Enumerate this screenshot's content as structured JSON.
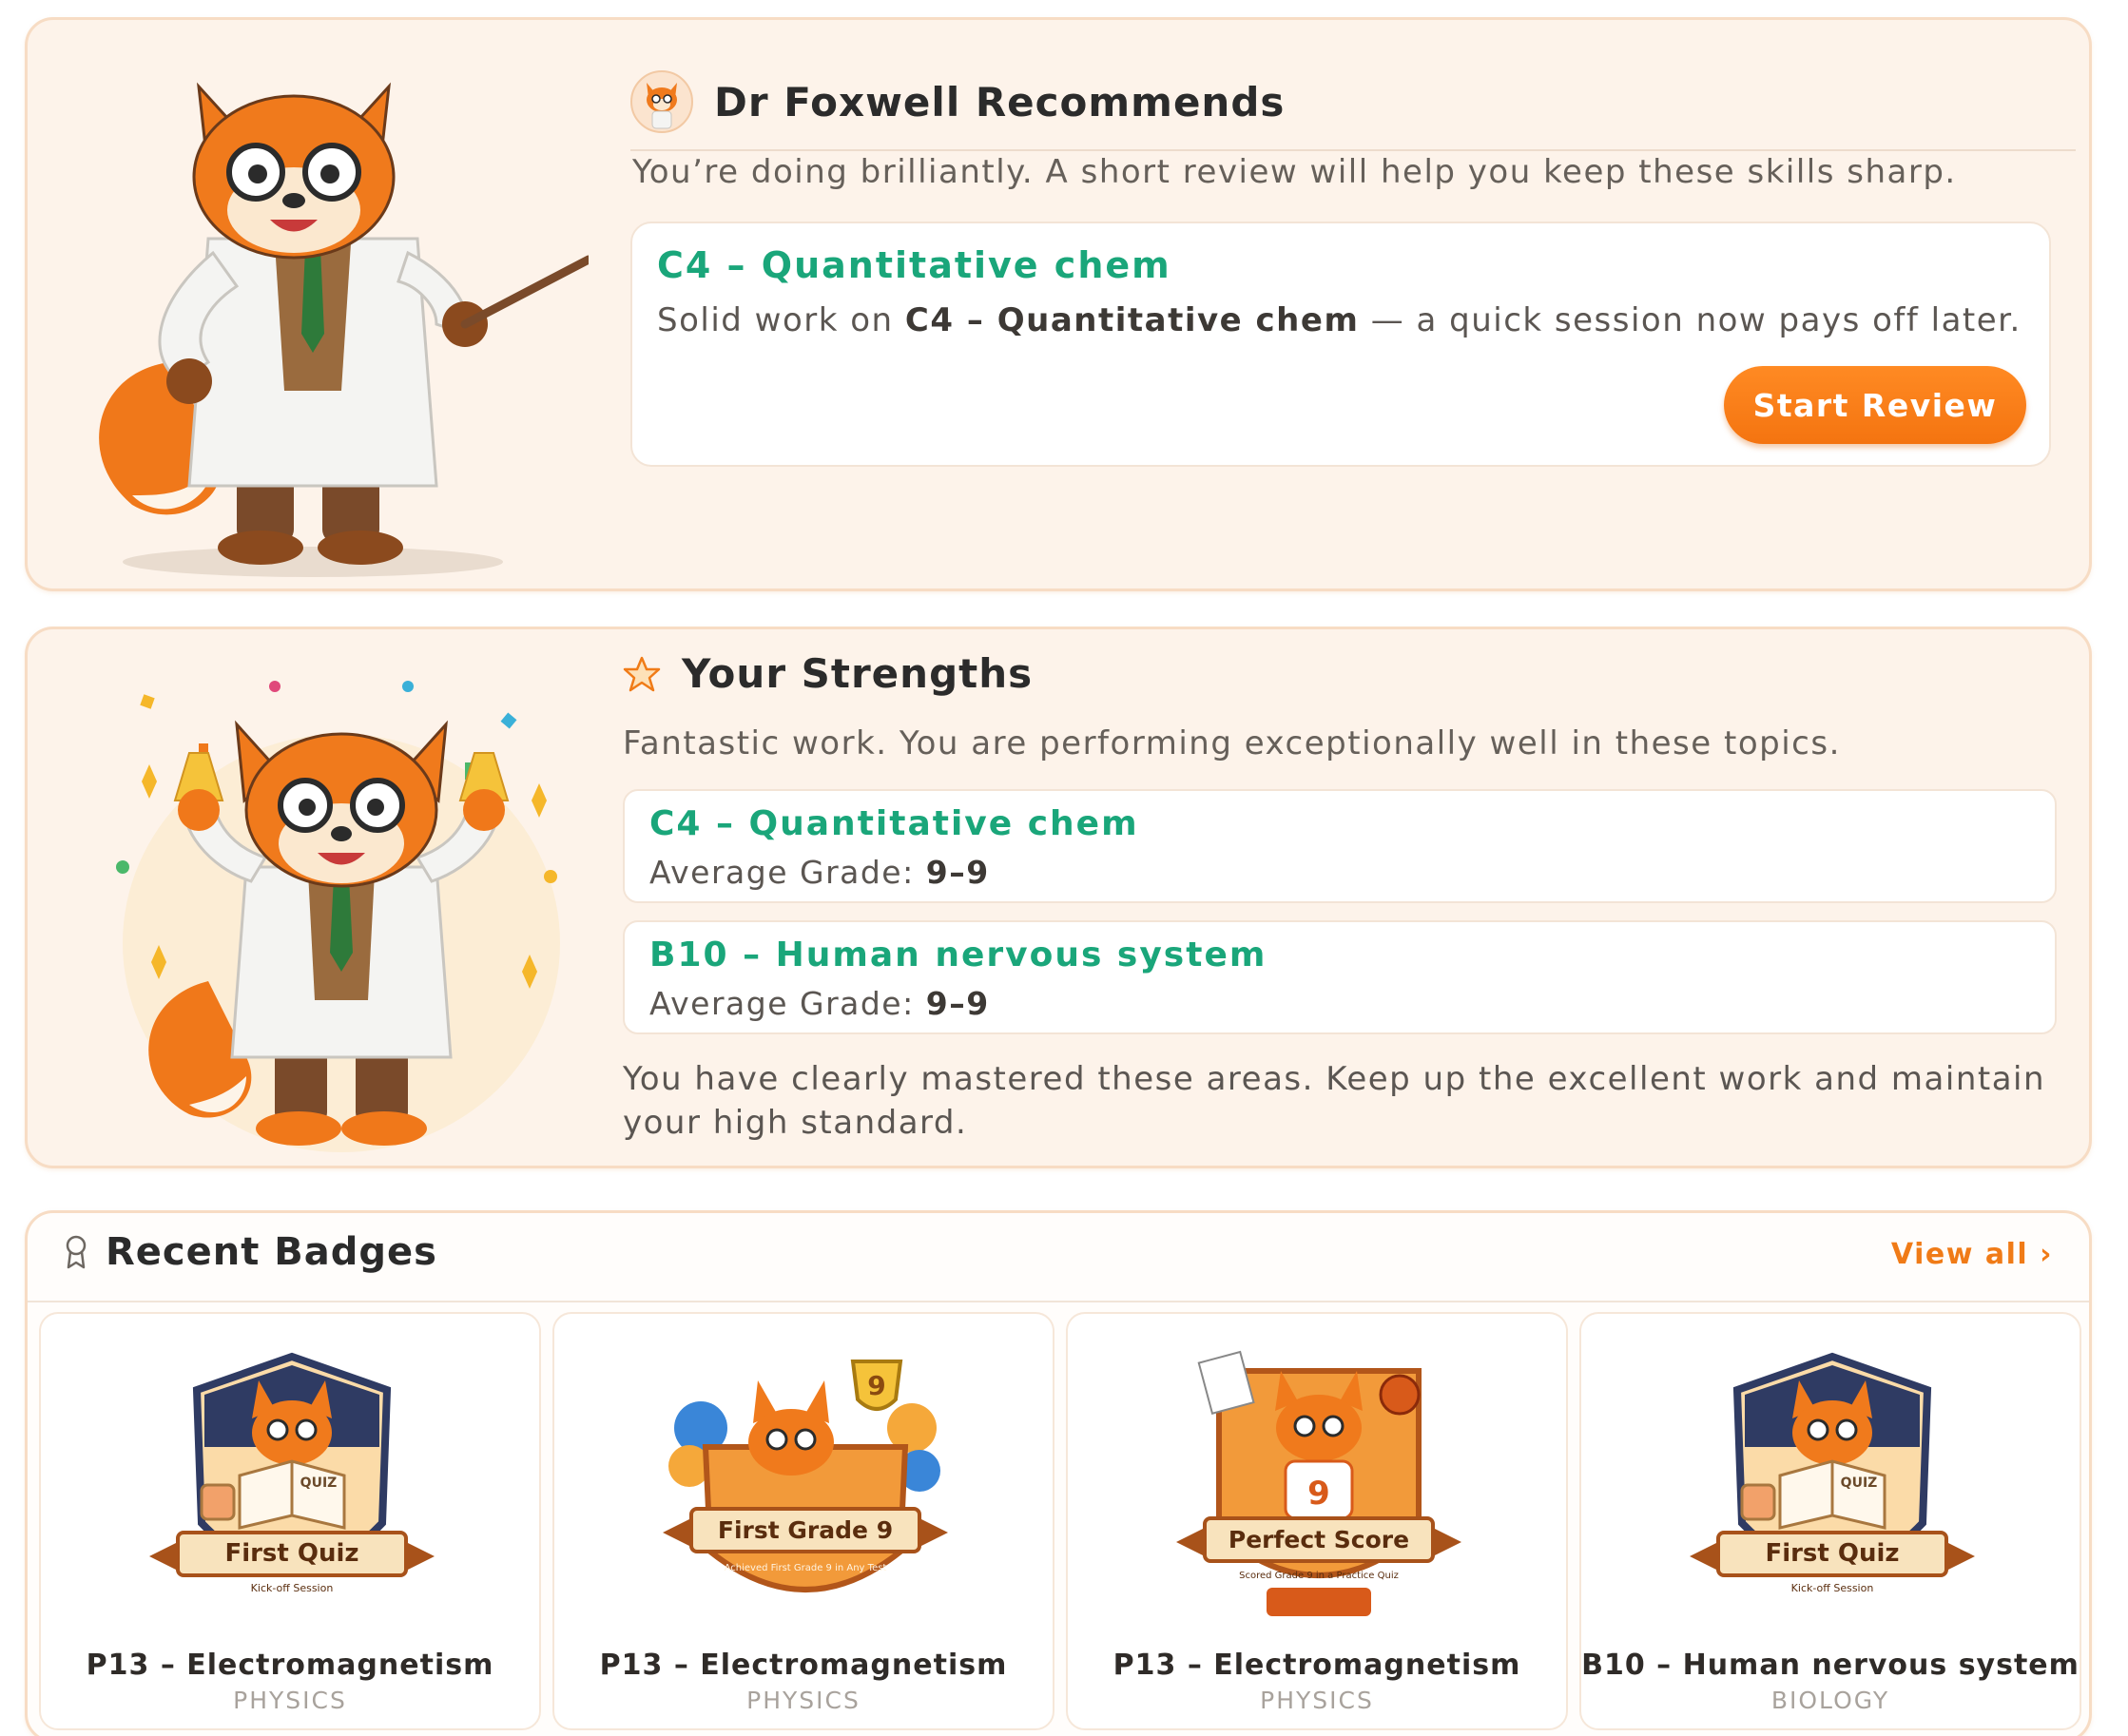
{
  "recommend": {
    "title": "Dr Foxwell Recommends",
    "subtitle": "You’re doing brilliantly. A short review will help you keep these skills sharp.",
    "topic": "C4 – Quantitative chem",
    "desc_prefix": "Solid work on ",
    "desc_topic": "C4 – Quantitative chem",
    "desc_suffix": " — a quick session now pays off later.",
    "button": "Start Review"
  },
  "strengths": {
    "title": "Your Strengths",
    "subtitle": "Fantastic work. You are performing exceptionally well in these topics.",
    "grade_label": "Average Grade: ",
    "items": [
      {
        "topic": "C4 – Quantitative chem",
        "grade": "9–9"
      },
      {
        "topic": "B10 – Human nervous system",
        "grade": "9–9"
      }
    ],
    "footer": "You have clearly mastered these areas. Keep up the excellent work and maintain your high standard."
  },
  "badges": {
    "title": "Recent Badges",
    "view_all": "View all ›",
    "items": [
      {
        "art_title": "First Quiz",
        "art_sub": "Kick-off Session",
        "topic": "P13 – Electromagnetism",
        "subject": "PHYSICS",
        "icon": "first-quiz-badge"
      },
      {
        "art_title": "First Grade 9",
        "art_sub": "Achieved First Grade 9 in Any Test",
        "topic": "P13 – Electromagnetism",
        "subject": "PHYSICS",
        "icon": "first-grade-9-badge"
      },
      {
        "art_title": "Perfect Score",
        "art_sub": "Scored Grade 9 in a Practice Quiz",
        "topic": "P13 – Electromagnetism",
        "subject": "PHYSICS",
        "icon": "perfect-score-badge"
      },
      {
        "art_title": "First Quiz",
        "art_sub": "Kick-off Session",
        "topic": "B10 – Human nervous system",
        "subject": "BIOLOGY",
        "icon": "first-quiz-badge"
      }
    ],
    "art_labels": {
      "quiz": "QUIZ",
      "nine": "9"
    }
  },
  "colors": {
    "accent_orange": "#f47410",
    "topic_green": "#1aa67a",
    "card_bg": "#fdf3ea"
  }
}
